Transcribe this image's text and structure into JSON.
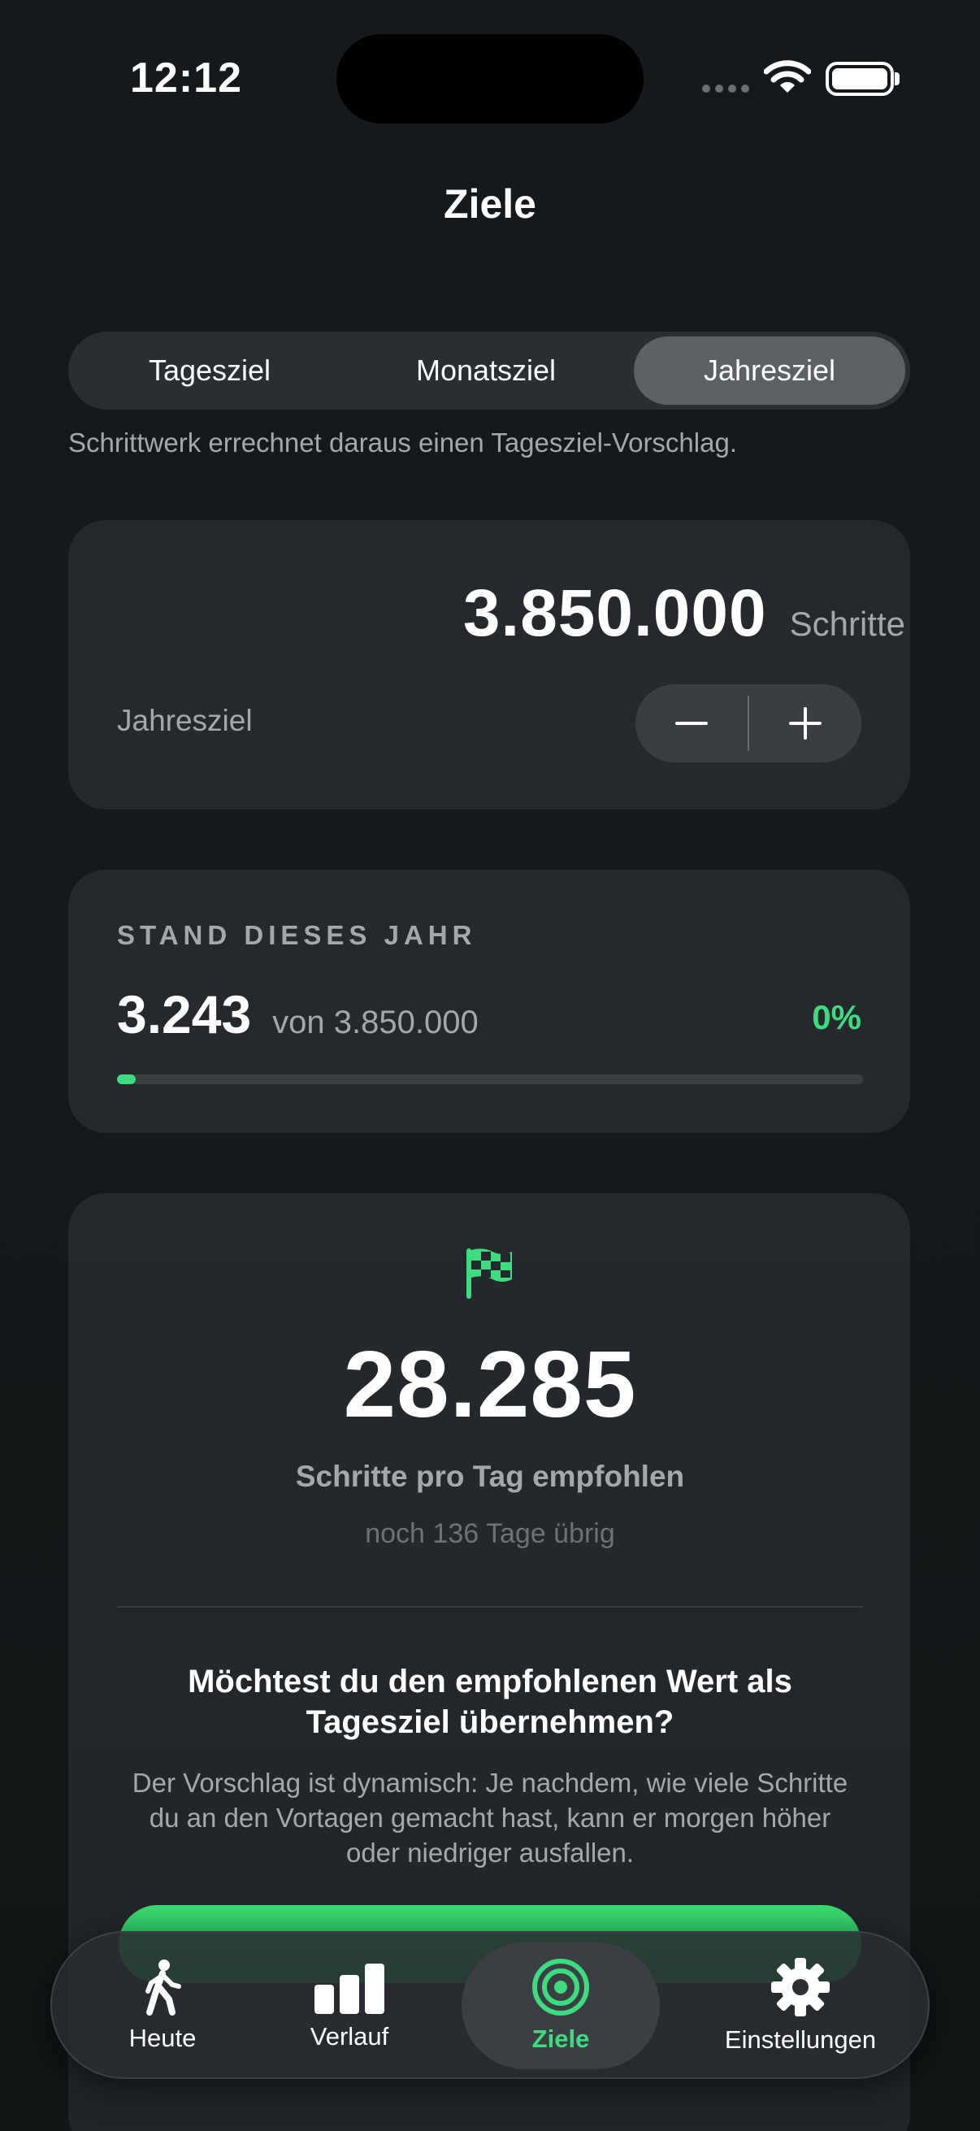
{
  "status_bar": {
    "time": "12:12"
  },
  "header": {
    "title": "Ziele"
  },
  "segmented": {
    "options": [
      "Tagesziel",
      "Monatsziel",
      "Jahresziel"
    ],
    "selected": "Jahresziel"
  },
  "hint": "Schrittwerk errechnet daraus einen Tagesziel-Vorschlag.",
  "goal_card": {
    "value": "3.850.000",
    "unit": "Schritte",
    "label": "Jahresziel",
    "minus": "−",
    "plus": "+"
  },
  "progress_card": {
    "heading": "STAND DIESES JAHR",
    "current": "3.243",
    "of_text": "von 3.850.000",
    "percent_text": "0%",
    "progress_fraction": 0.0084
  },
  "recommendation_card": {
    "value": "28.285",
    "label": "Schritte pro Tag empfohlen",
    "days_left": "noch 136 Tage übrig",
    "question": "Möchtest du den empfohlenen Wert als Tagesziel übernehmen?",
    "explanation": "Der Vorschlag ist dynamisch: Je nachdem, wie viele Schritte du an den Vortagen gemacht hast, kann er morgen höher oder niedriger ausfallen."
  },
  "tabbar": {
    "tabs": [
      {
        "label": "Heute",
        "icon": "walking-person-icon"
      },
      {
        "label": "Verlauf",
        "icon": "bar-chart-icon"
      },
      {
        "label": "Ziele",
        "icon": "target-icon"
      },
      {
        "label": "Einstellungen",
        "icon": "gear-icon"
      }
    ],
    "active": "Ziele"
  },
  "colors": {
    "accent": "#3ddc7e",
    "background": "#14191b",
    "card": "#25292d"
  }
}
